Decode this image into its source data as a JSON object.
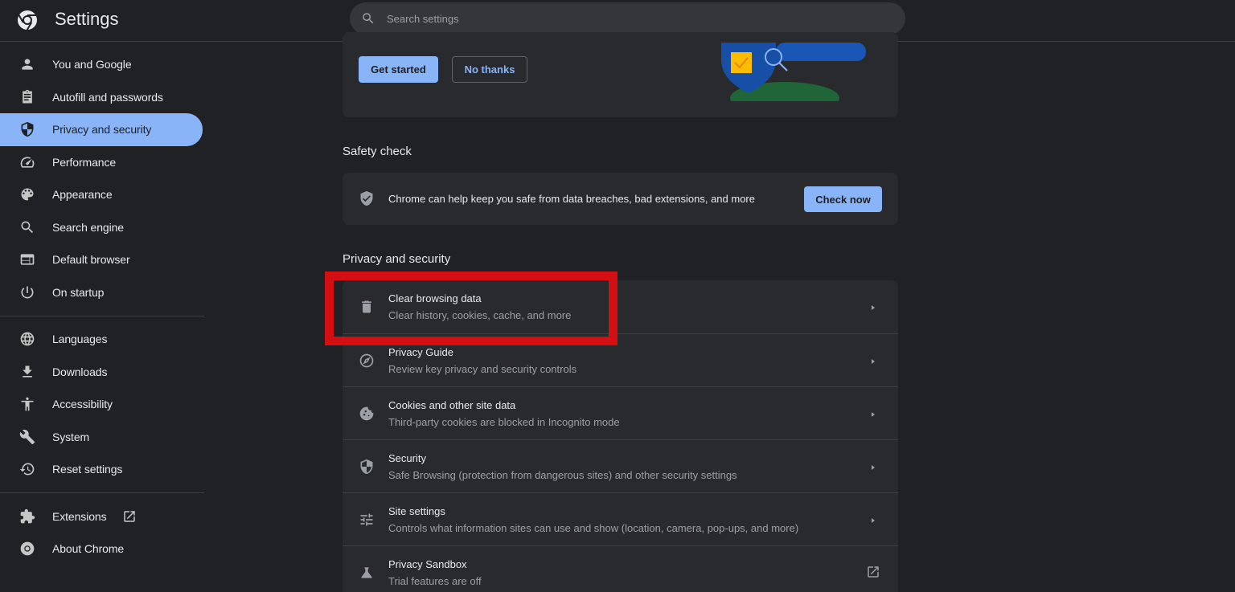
{
  "header": {
    "title": "Settings",
    "search_placeholder": "Search settings"
  },
  "sidebar": {
    "items": [
      {
        "label": "You and Google",
        "icon": "person-icon"
      },
      {
        "label": "Autofill and passwords",
        "icon": "clipboard-icon"
      },
      {
        "label": "Privacy and security",
        "icon": "shield-icon",
        "active": true
      },
      {
        "label": "Performance",
        "icon": "speedometer-icon"
      },
      {
        "label": "Appearance",
        "icon": "palette-icon"
      },
      {
        "label": "Search engine",
        "icon": "search-icon"
      },
      {
        "label": "Default browser",
        "icon": "browser-icon"
      },
      {
        "label": "On startup",
        "icon": "power-icon"
      }
    ],
    "advanced": [
      {
        "label": "Languages",
        "icon": "globe-icon"
      },
      {
        "label": "Downloads",
        "icon": "download-icon"
      },
      {
        "label": "Accessibility",
        "icon": "accessibility-icon"
      },
      {
        "label": "System",
        "icon": "wrench-icon"
      },
      {
        "label": "Reset settings",
        "icon": "history-icon"
      }
    ],
    "footer": [
      {
        "label": "Extensions",
        "icon": "puzzle-icon"
      },
      {
        "label": "About Chrome",
        "icon": "chrome-icon"
      }
    ]
  },
  "promo": {
    "primary_label": "Get started",
    "secondary_label": "No thanks"
  },
  "safety_check": {
    "title": "Safety check",
    "description": "Chrome can help keep you safe from data breaches, bad extensions, and more",
    "button_label": "Check now"
  },
  "privacy": {
    "title": "Privacy and security",
    "rows": [
      {
        "title": "Clear browsing data",
        "subtitle": "Clear history, cookies, cache, and more",
        "icon": "trash-icon"
      },
      {
        "title": "Privacy Guide",
        "subtitle": "Review key privacy and security controls",
        "icon": "compass-icon"
      },
      {
        "title": "Cookies and other site data",
        "subtitle": "Third-party cookies are blocked in Incognito mode",
        "icon": "cookie-icon"
      },
      {
        "title": "Security",
        "subtitle": "Safe Browsing (protection from dangerous sites) and other security settings",
        "icon": "shield-icon"
      },
      {
        "title": "Site settings",
        "subtitle": "Controls what information sites can use and show (location, camera, pop-ups, and more)",
        "icon": "tune-icon"
      },
      {
        "title": "Privacy Sandbox",
        "subtitle": "Trial features are off",
        "icon": "flask-icon"
      }
    ]
  },
  "colors": {
    "accent": "#8ab4f8",
    "background": "#202124",
    "card": "#292a2d",
    "highlight": "#d40f14"
  }
}
